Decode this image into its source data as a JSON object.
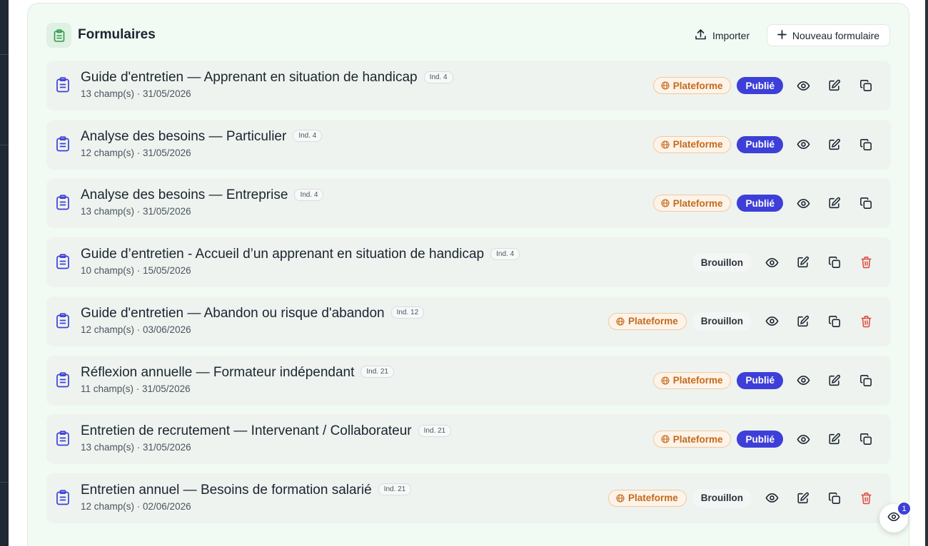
{
  "header": {
    "title": "Formulaires",
    "import_label": "Importer",
    "new_label": "Nouveau formulaire"
  },
  "forms": [
    {
      "title": "Guide d'entretien — Apprenant en situation de handicap",
      "ind": "Ind. 4",
      "meta": "13 champ(s) · 31/05/2026",
      "platform": "Plateforme",
      "status": "Publié",
      "deletable": false
    },
    {
      "title": "Analyse des besoins — Particulier",
      "ind": "Ind. 4",
      "meta": "12 champ(s) · 31/05/2026",
      "platform": "Plateforme",
      "status": "Publié",
      "deletable": false
    },
    {
      "title": "Analyse des besoins — Entreprise",
      "ind": "Ind. 4",
      "meta": "13 champ(s) · 31/05/2026",
      "platform": "Plateforme",
      "status": "Publié",
      "deletable": false
    },
    {
      "title": "Guide d’entretien - Accueil d’un apprenant en situation de handicap",
      "ind": "Ind. 4",
      "meta": "10 champ(s) · 15/05/2026",
      "platform": "",
      "status": "Brouillon",
      "deletable": true
    },
    {
      "title": "Guide d'entretien — Abandon ou risque d'abandon",
      "ind": "Ind. 12",
      "meta": "12 champ(s) · 03/06/2026",
      "platform": "Plateforme",
      "status": "Brouillon",
      "deletable": true
    },
    {
      "title": "Réflexion annuelle — Formateur indépendant",
      "ind": "Ind. 21",
      "meta": "11 champ(s) · 31/05/2026",
      "platform": "Plateforme",
      "status": "Publié",
      "deletable": false
    },
    {
      "title": "Entretien de recrutement — Intervenant / Collaborateur",
      "ind": "Ind. 21",
      "meta": "13 champ(s) · 31/05/2026",
      "platform": "Plateforme",
      "status": "Publié",
      "deletable": false
    },
    {
      "title": "Entretien annuel — Besoins de formation salarié",
      "ind": "Ind. 21",
      "meta": "12 champ(s) · 02/06/2026",
      "platform": "Plateforme",
      "status": "Brouillon",
      "deletable": true
    }
  ],
  "fab": {
    "badge_count": "1"
  },
  "colors": {
    "accent": "#3d3fd8",
    "platform": "#c46a1c",
    "delete": "#e0483e",
    "icon": "#3d3fd8",
    "header_icon": "#2f9a4a"
  },
  "icons": {
    "form": "clipboard-icon",
    "platform": "globe-icon",
    "view": "eye-icon",
    "edit": "edit-icon",
    "duplicate": "copy-icon",
    "delete": "trash-icon",
    "import": "upload-icon",
    "new": "plus-icon"
  }
}
